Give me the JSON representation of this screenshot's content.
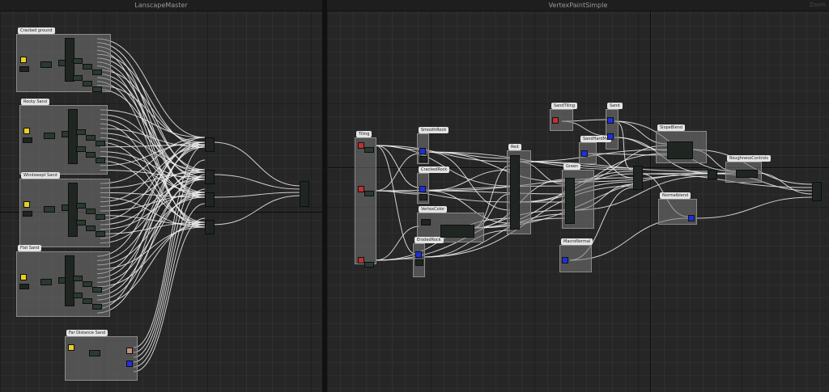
{
  "graphs": [
    {
      "title": "LanscapeMaster"
    },
    {
      "title": "VertexPaintSimple",
      "corner_label": "Zoom"
    }
  ],
  "left_comments": [
    {
      "label": "Cracked ground"
    },
    {
      "label": "Rocky Sand"
    },
    {
      "label": "Windswept Sand"
    },
    {
      "label": "Flat Sand"
    },
    {
      "label": "Far Distance Sand"
    }
  ],
  "right_comments": [
    {
      "label": "Tiling"
    },
    {
      "label": "SmoothRock"
    },
    {
      "label": "CrackedRock"
    },
    {
      "label": "VertexColor"
    },
    {
      "label": "ErodedRock"
    },
    {
      "label": "Red"
    },
    {
      "label": "Green"
    },
    {
      "label": "SandTiling"
    },
    {
      "label": "Sand"
    },
    {
      "label": "SandHardMa"
    },
    {
      "label": "SlopeBlend"
    },
    {
      "label": "RoughnessControls"
    },
    {
      "label": "Normalblend"
    },
    {
      "label": "MacroNormal"
    }
  ],
  "colors": {
    "canvas": "#262626",
    "comment_box": "#767676",
    "wire": "#f0f0f0",
    "texture_blue": "#1f2fe0",
    "texture_tan": "#c8927a",
    "texture_pink": "#e8a0e8",
    "texture_yellow": "#e8d020",
    "texture_green": "#2e8a3a"
  }
}
